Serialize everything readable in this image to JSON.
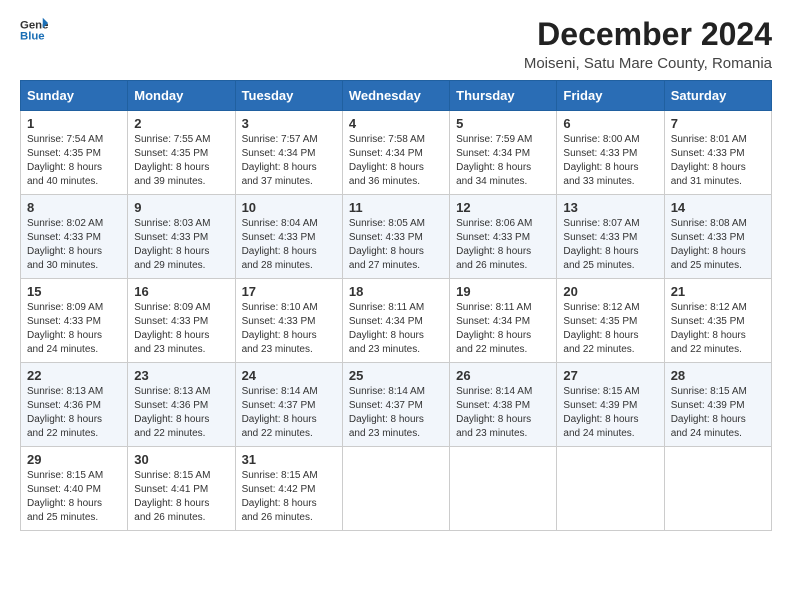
{
  "logo": {
    "line1": "General",
    "line2": "Blue"
  },
  "title": "December 2024",
  "subtitle": "Moiseni, Satu Mare County, Romania",
  "weekdays": [
    "Sunday",
    "Monday",
    "Tuesday",
    "Wednesday",
    "Thursday",
    "Friday",
    "Saturday"
  ],
  "weeks": [
    [
      {
        "day": "1",
        "sunrise": "Sunrise: 7:54 AM",
        "sunset": "Sunset: 4:35 PM",
        "daylight": "Daylight: 8 hours and 40 minutes."
      },
      {
        "day": "2",
        "sunrise": "Sunrise: 7:55 AM",
        "sunset": "Sunset: 4:35 PM",
        "daylight": "Daylight: 8 hours and 39 minutes."
      },
      {
        "day": "3",
        "sunrise": "Sunrise: 7:57 AM",
        "sunset": "Sunset: 4:34 PM",
        "daylight": "Daylight: 8 hours and 37 minutes."
      },
      {
        "day": "4",
        "sunrise": "Sunrise: 7:58 AM",
        "sunset": "Sunset: 4:34 PM",
        "daylight": "Daylight: 8 hours and 36 minutes."
      },
      {
        "day": "5",
        "sunrise": "Sunrise: 7:59 AM",
        "sunset": "Sunset: 4:34 PM",
        "daylight": "Daylight: 8 hours and 34 minutes."
      },
      {
        "day": "6",
        "sunrise": "Sunrise: 8:00 AM",
        "sunset": "Sunset: 4:33 PM",
        "daylight": "Daylight: 8 hours and 33 minutes."
      },
      {
        "day": "7",
        "sunrise": "Sunrise: 8:01 AM",
        "sunset": "Sunset: 4:33 PM",
        "daylight": "Daylight: 8 hours and 31 minutes."
      }
    ],
    [
      {
        "day": "8",
        "sunrise": "Sunrise: 8:02 AM",
        "sunset": "Sunset: 4:33 PM",
        "daylight": "Daylight: 8 hours and 30 minutes."
      },
      {
        "day": "9",
        "sunrise": "Sunrise: 8:03 AM",
        "sunset": "Sunset: 4:33 PM",
        "daylight": "Daylight: 8 hours and 29 minutes."
      },
      {
        "day": "10",
        "sunrise": "Sunrise: 8:04 AM",
        "sunset": "Sunset: 4:33 PM",
        "daylight": "Daylight: 8 hours and 28 minutes."
      },
      {
        "day": "11",
        "sunrise": "Sunrise: 8:05 AM",
        "sunset": "Sunset: 4:33 PM",
        "daylight": "Daylight: 8 hours and 27 minutes."
      },
      {
        "day": "12",
        "sunrise": "Sunrise: 8:06 AM",
        "sunset": "Sunset: 4:33 PM",
        "daylight": "Daylight: 8 hours and 26 minutes."
      },
      {
        "day": "13",
        "sunrise": "Sunrise: 8:07 AM",
        "sunset": "Sunset: 4:33 PM",
        "daylight": "Daylight: 8 hours and 25 minutes."
      },
      {
        "day": "14",
        "sunrise": "Sunrise: 8:08 AM",
        "sunset": "Sunset: 4:33 PM",
        "daylight": "Daylight: 8 hours and 25 minutes."
      }
    ],
    [
      {
        "day": "15",
        "sunrise": "Sunrise: 8:09 AM",
        "sunset": "Sunset: 4:33 PM",
        "daylight": "Daylight: 8 hours and 24 minutes."
      },
      {
        "day": "16",
        "sunrise": "Sunrise: 8:09 AM",
        "sunset": "Sunset: 4:33 PM",
        "daylight": "Daylight: 8 hours and 23 minutes."
      },
      {
        "day": "17",
        "sunrise": "Sunrise: 8:10 AM",
        "sunset": "Sunset: 4:33 PM",
        "daylight": "Daylight: 8 hours and 23 minutes."
      },
      {
        "day": "18",
        "sunrise": "Sunrise: 8:11 AM",
        "sunset": "Sunset: 4:34 PM",
        "daylight": "Daylight: 8 hours and 23 minutes."
      },
      {
        "day": "19",
        "sunrise": "Sunrise: 8:11 AM",
        "sunset": "Sunset: 4:34 PM",
        "daylight": "Daylight: 8 hours and 22 minutes."
      },
      {
        "day": "20",
        "sunrise": "Sunrise: 8:12 AM",
        "sunset": "Sunset: 4:35 PM",
        "daylight": "Daylight: 8 hours and 22 minutes."
      },
      {
        "day": "21",
        "sunrise": "Sunrise: 8:12 AM",
        "sunset": "Sunset: 4:35 PM",
        "daylight": "Daylight: 8 hours and 22 minutes."
      }
    ],
    [
      {
        "day": "22",
        "sunrise": "Sunrise: 8:13 AM",
        "sunset": "Sunset: 4:36 PM",
        "daylight": "Daylight: 8 hours and 22 minutes."
      },
      {
        "day": "23",
        "sunrise": "Sunrise: 8:13 AM",
        "sunset": "Sunset: 4:36 PM",
        "daylight": "Daylight: 8 hours and 22 minutes."
      },
      {
        "day": "24",
        "sunrise": "Sunrise: 8:14 AM",
        "sunset": "Sunset: 4:37 PM",
        "daylight": "Daylight: 8 hours and 22 minutes."
      },
      {
        "day": "25",
        "sunrise": "Sunrise: 8:14 AM",
        "sunset": "Sunset: 4:37 PM",
        "daylight": "Daylight: 8 hours and 23 minutes."
      },
      {
        "day": "26",
        "sunrise": "Sunrise: 8:14 AM",
        "sunset": "Sunset: 4:38 PM",
        "daylight": "Daylight: 8 hours and 23 minutes."
      },
      {
        "day": "27",
        "sunrise": "Sunrise: 8:15 AM",
        "sunset": "Sunset: 4:39 PM",
        "daylight": "Daylight: 8 hours and 24 minutes."
      },
      {
        "day": "28",
        "sunrise": "Sunrise: 8:15 AM",
        "sunset": "Sunset: 4:39 PM",
        "daylight": "Daylight: 8 hours and 24 minutes."
      }
    ],
    [
      {
        "day": "29",
        "sunrise": "Sunrise: 8:15 AM",
        "sunset": "Sunset: 4:40 PM",
        "daylight": "Daylight: 8 hours and 25 minutes."
      },
      {
        "day": "30",
        "sunrise": "Sunrise: 8:15 AM",
        "sunset": "Sunset: 4:41 PM",
        "daylight": "Daylight: 8 hours and 26 minutes."
      },
      {
        "day": "31",
        "sunrise": "Sunrise: 8:15 AM",
        "sunset": "Sunset: 4:42 PM",
        "daylight": "Daylight: 8 hours and 26 minutes."
      },
      null,
      null,
      null,
      null
    ]
  ]
}
